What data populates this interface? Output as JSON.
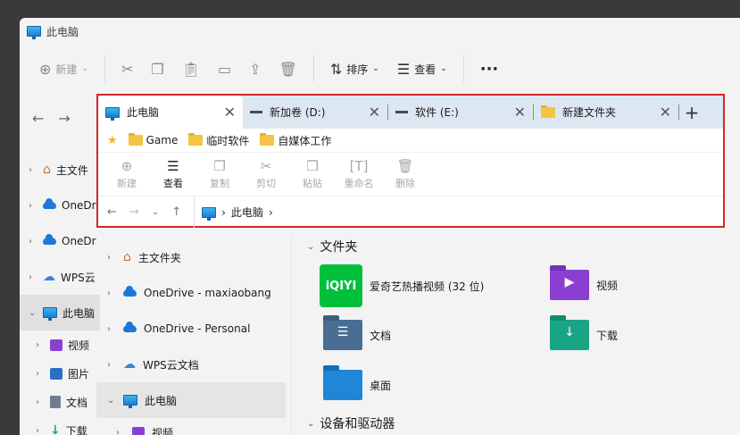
{
  "window": {
    "title": "此电脑"
  },
  "cmdbar": {
    "new_label": "新建",
    "sort_label": "排序",
    "view_label": "查看",
    "more": "···"
  },
  "leftnav": {
    "items": [
      {
        "label": "主文件"
      },
      {
        "label": "OneDr"
      },
      {
        "label": "OneDr"
      },
      {
        "label": "WPS云"
      },
      {
        "label": "此电脑"
      },
      {
        "label": "视频"
      },
      {
        "label": "图片"
      },
      {
        "label": "文档"
      },
      {
        "label": "下载"
      }
    ]
  },
  "tabs": [
    {
      "label": "此电脑",
      "close": "✕"
    },
    {
      "label": "新加卷 (D:)",
      "close": "✕"
    },
    {
      "label": "软件 (E:)",
      "close": "✕"
    },
    {
      "label": "新建文件夹",
      "close": "✕"
    }
  ],
  "new_tab": "+",
  "favorites": [
    "Game",
    "临时软件",
    "自媒体工作"
  ],
  "ribbon": {
    "new": "新建",
    "view": "查看",
    "copy": "复制",
    "cut": "剪切",
    "paste": "粘贴",
    "rename": "重命名",
    "delete": "删除"
  },
  "address": {
    "location": "此电脑",
    "sep": "›"
  },
  "inner_nav": [
    {
      "label": "主文件夹"
    },
    {
      "label": "OneDrive - maxiaobang"
    },
    {
      "label": "OneDrive - Personal"
    },
    {
      "label": "WPS云文档"
    },
    {
      "label": "此电脑"
    },
    {
      "label": "视频"
    }
  ],
  "content": {
    "folders_section": "文件夹",
    "items": [
      {
        "label": "爱奇艺热播视频 (32 位)",
        "icon_text": "iQIYI"
      },
      {
        "label": "视频"
      },
      {
        "label": "文档"
      },
      {
        "label": "下载"
      },
      {
        "label": "桌面"
      }
    ],
    "drives_section": "设备和驱动器"
  }
}
